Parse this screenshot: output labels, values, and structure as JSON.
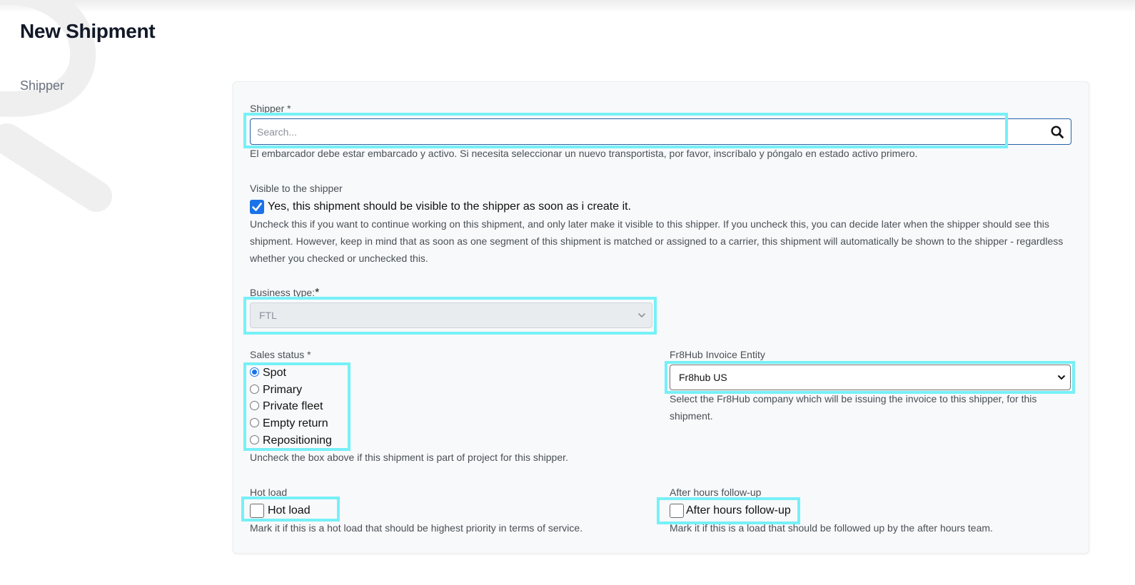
{
  "page": {
    "title": "New Shipment",
    "section_label": "Shipper"
  },
  "shipper": {
    "label": "Shipper *",
    "placeholder": "Search...",
    "help": "El embarcador debe estar embarcado y activo. Si necesita seleccionar un nuevo transportista, por favor, inscríbalo y póngalo en estado activo primero."
  },
  "visible": {
    "label": "Visible to the shipper",
    "checkbox_label": "Yes, this shipment should be visible to the shipper as soon as i create it.",
    "checked": true,
    "help_lines": [
      "Uncheck this if you want to continue working on this shipment, and only later make it visible to this shipper. If you uncheck this, you can decide later when the shipper should see this",
      "shipment. However, keep in mind that as soon as one segment of this shipment is matched or assigned to a carrier, this shipment will automatically be shown to the shipper - regardless",
      "whether you checked or unchecked this."
    ]
  },
  "business_type": {
    "label": "Business type:",
    "required_mark": "*",
    "value": "FTL"
  },
  "sales_status": {
    "label": "Sales status *",
    "options": [
      "Spot",
      "Primary",
      "Private fleet",
      "Empty return",
      "Repositioning"
    ],
    "selected": "Spot",
    "help": "Uncheck the box above if this shipment is part of project for this shipper."
  },
  "invoice_entity": {
    "label": "Fr8Hub Invoice Entity",
    "value": "Fr8hub US",
    "help_lines": [
      "Select the Fr8Hub company which will be issuing the invoice to this shipper, for this",
      "shipment."
    ]
  },
  "hot_load": {
    "label": "Hot load",
    "checkbox_label": "Hot load",
    "help": "Mark it if this is a hot load that should be highest priority in terms of service."
  },
  "after_hours": {
    "label": "After hours follow-up",
    "checkbox_label": "After hours follow-up",
    "help": "Mark it if this is a load that should be followed up by the after hours team."
  },
  "colors": {
    "accent": "#1a73e8",
    "highlight": "#76f0f7",
    "input_border": "#2563a8"
  }
}
